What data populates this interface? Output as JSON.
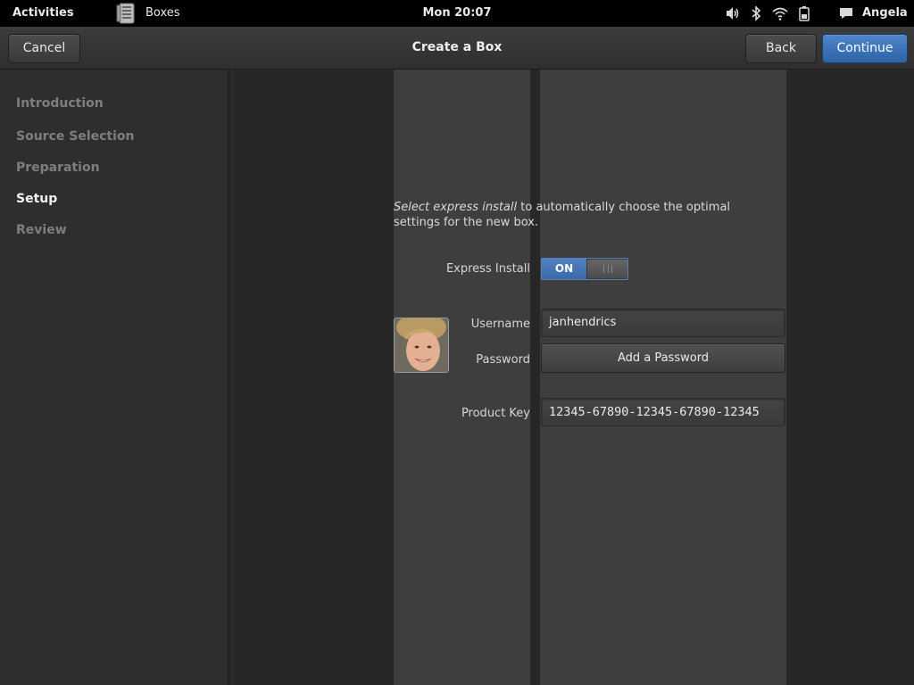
{
  "topbar": {
    "activities": "Activities",
    "app_name": "Boxes",
    "clock": "Mon 20:07",
    "user": "Angela"
  },
  "header": {
    "title": "Create a Box",
    "cancel": "Cancel",
    "back": "Back",
    "continue": "Continue"
  },
  "sidebar": {
    "items": [
      {
        "label": "Introduction"
      },
      {
        "label": "Source Selection"
      },
      {
        "label": "Preparation"
      },
      {
        "label": "Setup"
      },
      {
        "label": "Review"
      }
    ]
  },
  "setup": {
    "desc_emph": "Select express install",
    "desc_rest": " to automatically choose the optimal settings for the new box.",
    "express_label": "Express Install",
    "toggle_on": "ON",
    "username_label": "Username",
    "username_value": "janhendrics",
    "password_label": "Password",
    "password_button": "Add a Password",
    "product_key_label": "Product Key",
    "product_key_value": "12345-67890-12345-67890-12345"
  },
  "colors": {
    "accent": "#3c6aa8",
    "sidebar_active": "#f2f2f2",
    "sidebar_inactive": "#7e7e7e"
  }
}
